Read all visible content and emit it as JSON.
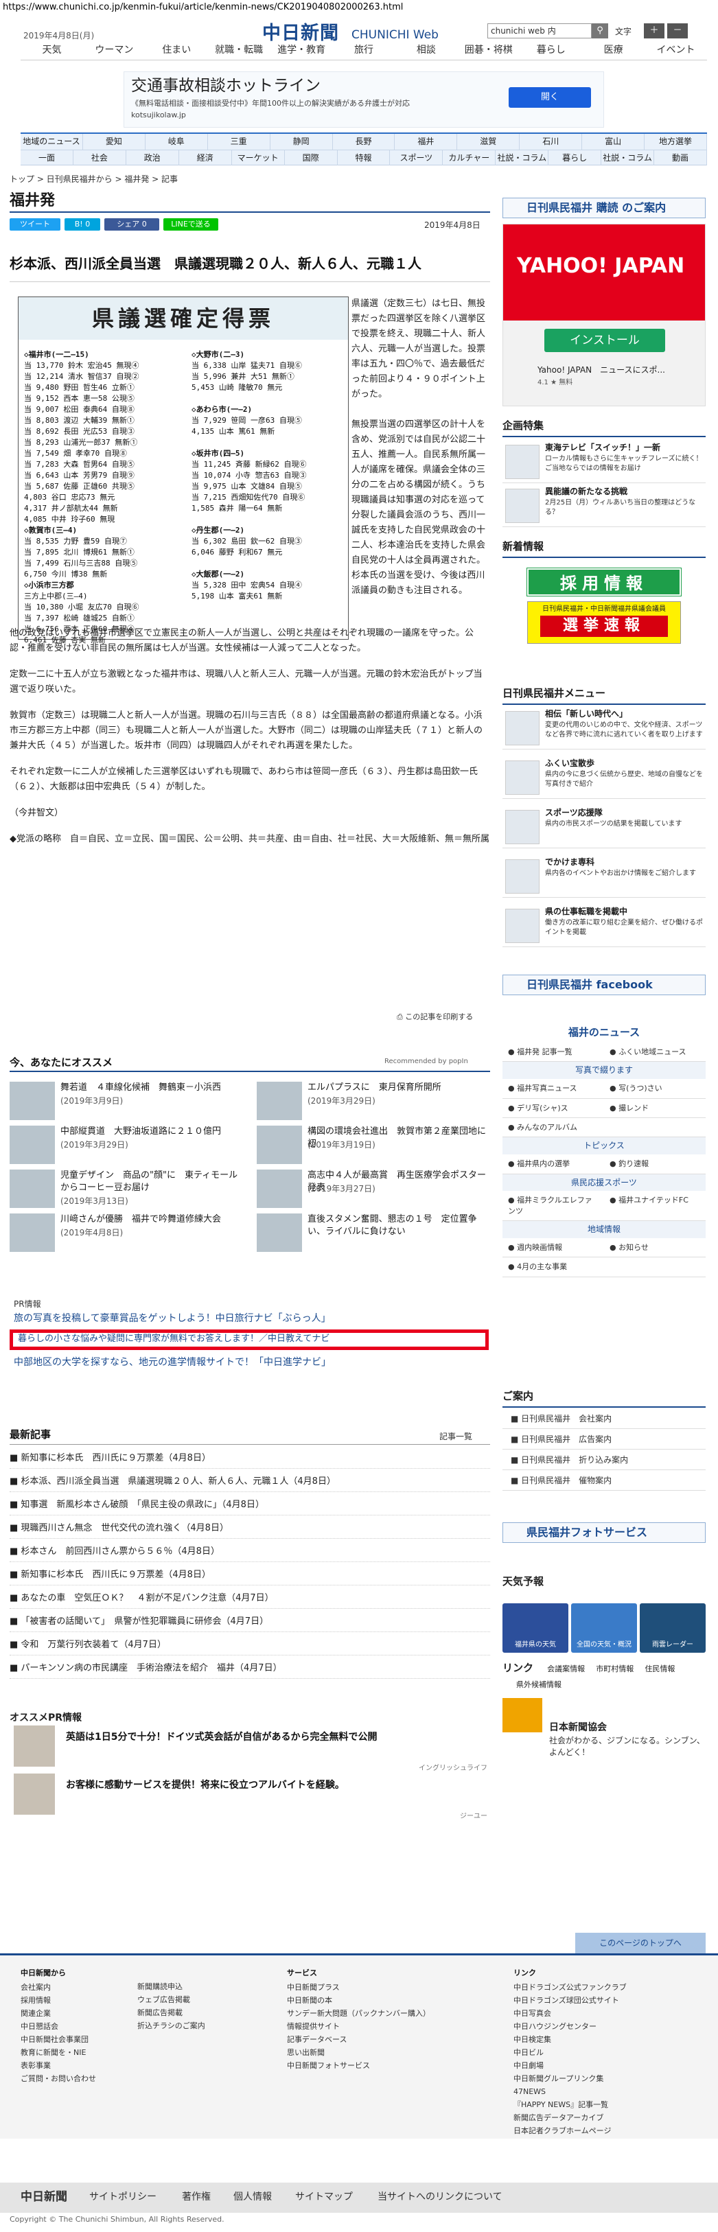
{
  "url": "https://www.chunichi.co.jp/kenmin-fukui/article/kenmin-news/CK2019040802000263.html",
  "header": {
    "date": "2019年4月8日(月)",
    "logo": "中日新聞",
    "logo_sub": "CHUNICHI Web",
    "search_value": "chunichi web 内",
    "font_label": "文字",
    "font_plus": "＋",
    "font_minus": "－"
  },
  "topnav": [
    "天気",
    "ウーマン",
    "住まい",
    "就職・転職",
    "進学・教育",
    "旅行",
    "相談",
    "囲碁・将棋",
    "暮らし",
    "医療",
    "イベント"
  ],
  "ad": {
    "title": "交通事故相談ホットライン",
    "sub": "《無料電話相談・面接相談受付中》年間100件以上の解決実績がある弁護士が対応 kotsujikolaw.jp",
    "button": "開く"
  },
  "bnav_row1": [
    "地域のニュース",
    "愛知",
    "岐阜",
    "三重",
    "静岡",
    "長野",
    "福井",
    "滋賀",
    "石川",
    "富山",
    "地方選挙"
  ],
  "bnav_row2": [
    "一面",
    "社会",
    "政治",
    "経済",
    "マーケット",
    "国際",
    "特報",
    "スポーツ",
    "カルチャー",
    "社説・コラム",
    "暮らし",
    "社説・コラム",
    "動画"
  ],
  "breadcrumb": "トップ > 日刊県民福井から > 福井発 > 記事",
  "section_title": "福井発",
  "share": {
    "tweet": "ツイート",
    "hatena": "B! 0",
    "facebook": "シェア 0",
    "line": "LINEで送る"
  },
  "article": {
    "date": "2019年4月8日",
    "title": "杉本派、西川派全員当選　県議選現職２０人、新人６人、元職１人",
    "photo_title": "県議選確定得票",
    "photo_left": [
      "◇福井市(一二―15)",
      "当 13,770 鈴木 宏治45 無現④",
      "当 12,214 清水 智信37 自現②",
      "当  9,480 野田 哲生46 立新①",
      "当  9,152 西本 恵一58 公現⑤",
      "当  9,007 松田 泰典64 自現⑧",
      "当  8,803 渡辺 大輔39 無新①",
      "当  8,692 長田 光広53 自現③",
      "当  8,293 山浦光一郎37 無新①",
      "当  7,549 畑  孝幸70 自現⑧",
      "当  7,283 大森 哲男64 自現⑤",
      "当  6,643 山本 芳男79 自現⑨",
      "当  5,687 佐藤 正雄60 共現⑤",
      "    4,803 谷口 忠応73 無元",
      "    4,317 井ノ部航太44 無新",
      "    4,085 中井 玲子60 無現",
      "◇敦賀市(三―4)",
      "当  8,535 力野  豊59 自現⑦",
      "当  7,895 北川 博規61 無新①",
      "当  7,499 石川与三吉88 自現⑤",
      "    6,750 今川 博38 無新",
      "◇小浜市三方郡",
      "   三方上中郡(三―4)",
      "当 10,380 小堀 友広70 自現⑥",
      "当  7,397 松崎 雄城25 自新①",
      "当  6,756 西本 正俊60 無現④",
      "    6,461 佐藤 杏実 無新"
    ],
    "photo_right": [
      "◇大野市(二―3)",
      "当  6,338 山岸 猛夫71 自現⑥",
      "当  5,996 兼井   大51 無新①",
      "    5,453 山崎 隆敏70 無元",
      "",
      "◇あわら市(一―2)",
      "当  7,929 笹岡 一彦63 自現⑤",
      "    4,135 山本   篤61 無新",
      "",
      "◇坂井市(四―5)",
      "当 11,245 斉藤 新緑62 自現⑥",
      "当 10,074 小寺 惣吉63 自現③",
      "当  9,975 山本 文雄84 自現⑤",
      "当  7,215 西畑知佐代70 自現⑥",
      "    1,585 森井   陽一64 無新",
      "",
      "◇丹生郡(一―2)",
      "当  6,302 島田 欽一62 自現③",
      "    6,046 藤野 利和67 無元",
      "",
      "◇大飯郡(一―2)",
      "当  5,328 田中 宏典54 自現④",
      "    5,198 山本 富夫61 無新"
    ],
    "p1": "県議選（定数三七）は七日、無投票だった四選挙区を除く八選挙区で投票を終え、現職二十人、新人六人、元職一人が当選した。投票率は五九・四〇％で、過去最低だった前回より４・９０ポイント上がった。",
    "p2": "無投票当選の四選挙区の計十人を含め、党派別では自民が公認二十五人、推薦一人。自民系無所属一人が議席を確保。県議会全体の三分の二を占める構図が続く。うち現職議員は知事選の対応を巡って分裂した議員会派のうち、西川一誠氏を支持した自民党県政会の十二人、杉本達治氏を支持した県会自民党の十人は全員再選された。杉本氏の当選を受け、今後は西川派議員の動きも注目される。",
    "p3": "他の政党はいずれも福井市選挙区で立憲民主の新人一人が当選し、公明と共産はそれぞれ現職の一議席を守った。公認・推薦を受けない非自民の無所属は七人が当選。女性候補は一人減って二人となった。",
    "p4": "定数一二に十五人が立ち激戦となった福井市は、現職八人と新人三人、元職一人が当選。元職の鈴木宏治氏がトップ当選で返り咲いた。",
    "p5": "敦賀市（定数三）は現職二人と新人一人が当選。現職の石川与三吉氏（８８）は全国最高齢の都道府県議となる。小浜市三方郡三方上中郡（同三）も現職二人と新人一人が当選した。大野市（同二）は現職の山岸猛夫氏（７１）と新人の兼井大氏（４５）が当選した。坂井市（同四）は現職四人がそれぞれ再選を果たした。",
    "p6": "それぞれ定数一に二人が立候補した三選挙区はいずれも現職で、あわら市は笹岡一彦氏（６３）、丹生郡は島田欽一氏（６２）、大飯郡は田中宏典氏（５４）が制した。",
    "p7": "（今井智文）",
    "p8": "◆党派の略称　自＝自民、立＝立民、国＝国民、公＝公明、共＝共産、由＝自由、社＝社民、大＝大阪維新、無＝無所属",
    "print": "この記事を印刷する"
  },
  "recommend": {
    "heading": "今、あなたにオススメ",
    "by": "Recommended by popIn",
    "items": [
      {
        "title": "舞若道　４車線化候補　舞鶴東－小浜西",
        "date": "(2019年3月9日)"
      },
      {
        "title": "エルパプラスに　東月保育所開所",
        "date": "(2019年3月29日)"
      },
      {
        "title": "中部縦貫道　大野油坂道路に２１０億円",
        "date": "(2019年3月29日)"
      },
      {
        "title": "構図の環境会社進出　敦賀市第２産業団地に初",
        "date": "(2019年3月19日)"
      },
      {
        "title": "児童デザイン　商品の\"顔\"に　東ティモールからコーヒー豆お届け",
        "date": "(2019年3月13日)"
      },
      {
        "title": "高志中４人が最高賞　再生医療学会ポスター発表",
        "date": "(2019年3月27日)"
      },
      {
        "title": "川﨑さんが優勝　福井で吟舞道修練大会",
        "date": "(2019年4月8日)"
      },
      {
        "title": "直後スタメン奮闘、懇志の１号　定位置争い、ライバルに負けない",
        "date": ""
      }
    ]
  },
  "pr": {
    "label": "PR情報",
    "items": [
      "旅の写真を投稿して豪華賞品をゲットしよう！中日旅行ナビ「ぶらっ人」",
      "暮らしの小さな悩みや疑問に専門家が無料でお答えします！／中日教えてナビ",
      "中部地区の大学を探すなら、地元の進学情報サイトで！「中日進学ナビ」"
    ]
  },
  "latest": {
    "heading": "最新記事",
    "more": "記事一覧",
    "items": [
      "新知事に杉本氏　西川氏に９万票差（4月8日）",
      "杉本派、西川派全員当選　県議選現職２０人、新人６人、元職１人（4月8日）",
      "知事選　新風杉本さん破顔　「県民主役の県政に」（4月8日）",
      "現職西川さん無念　世代交代の流れ強く（4月8日）",
      "杉本さん　前回西川さん票から５６％（4月8日）",
      "新知事に杉本氏　西川氏に９万票差（4月8日）",
      "あなたの車　空気圧ＯＫ？　４割が不足パンク注意（4月7日）",
      "「被害者の話聞いて」　県警が性犯罪職員に研修会（4月7日）",
      "令和　万葉行列衣装着て（4月7日）",
      "パーキンソン病の市民講座　手術治療法を紹介　福井（4月7日）"
    ]
  },
  "osusume": {
    "heading": "オススメPR情報",
    "items": [
      {
        "title": "英語は1日5分で十分！ドイツ式英会話が自信があるから完全無料で公開",
        "src": "イングリッシュライフ"
      },
      {
        "title": "お客様に感動サービスを提供！将来に役立つアルバイトを経験。",
        "src": "ジーユー"
      }
    ]
  },
  "sidebar": {
    "kounyu": "日刊県民福井 購読 のご案内",
    "yahoo": {
      "logo": "YAHOO! JAPAN",
      "install": "インストール",
      "app": "Yahoo! JAPAN　ニュースにスポ...",
      "rating": "4.1 ★ 無料"
    },
    "kikaku_h": "企画特集",
    "kikaku": [
      {
        "title": "東海テレビ「スイッチ！」一新",
        "sub": "ローカル情報もさらに生キャッチフレーズに続く！ご当地ならではの情報をお届け"
      },
      {
        "title": "異能議の新たなる挑戦",
        "sub": "2月25日（月）ウィルあいち当日の整理はどうなる？"
      }
    ],
    "shinchaku_h": "新着情報",
    "saiyou": "採用情報",
    "senkyo_small": "日刊県民福井・中日新聞福井県議会議員",
    "senkyo": "選挙速報",
    "menu_h": "日刊県民福井メニュー",
    "menu": [
      {
        "title": "相伝「新しい時代へ」",
        "sub": "変更の代用のいじめの中で、文化や経済、スポーツなど各界で時に流れに逃れていく者を取り上げます"
      },
      {
        "title": "ふくい宝散歩",
        "sub": "県内の今に息づく伝統から歴史、地域の自慢などを写真付きで紹介"
      },
      {
        "title": "スポーツ応援隊",
        "sub": "県内の市民スポーツの結果を掲載しています"
      },
      {
        "title": "でかけま専科",
        "sub": "県内各のイベントやお出かけ情報をご紹介します"
      },
      {
        "title": "県の仕事転職を掲載中",
        "sub": "働き方の改革に取り組む企業を紹介、ぜひ働けるポイントを掲載"
      }
    ],
    "facebook": "日刊県民福井 facebook",
    "fn_h": "福井のニュース",
    "fn_top": [
      "福井発 記事一覧",
      "ふくい地域ニュース"
    ],
    "fn_sub1": "写真で綴ります",
    "fn_mid": [
      "福井写真ニュース",
      "写(うつ)さい",
      "デリ写(シャ)ス",
      "撮レンド",
      "みんなのアルバム",
      ""
    ],
    "fn_sub2": "トピックス",
    "fn_top2": [
      "福井県内の選挙",
      "釣り速報"
    ],
    "fn_sub3": "県民応援スポーツ",
    "fn_top3": [
      "福井ミラクルエレファンツ",
      "福井ユナイテッドFC"
    ],
    "fn_sub4": "地域情報",
    "fn_top4": [
      "週内映画情報",
      "お知らせ",
      "4月の主な事業",
      ""
    ],
    "annai_h": "ご案内",
    "annai": [
      "日刊県民福井　会社案内",
      "日刊県民福井　広告案内",
      "日刊県民福井　折り込み案内",
      "日刊県民福井　催物案内"
    ],
    "photo_service": "県民福井フォトサービス",
    "tenki_h": "天気予報",
    "tenki": [
      "福井県の天気",
      "全国の天気・概況",
      "雨雲レーダー"
    ],
    "link_h": "リンク",
    "link_items": [
      "会議案情報",
      "市町村情報",
      "住民情報",
      "県外候補情報"
    ],
    "nihon": "日本新聞協会",
    "nihon_sub": "社会がわかる、ジブンになる。シンブン、よんどく！"
  },
  "footer": {
    "top": "このページのトップへ",
    "col1": {
      "h": "中日新聞から",
      "items": [
        "会社案内",
        "採用情報",
        "関連企業",
        "中日懇話会",
        "中日新聞社会事業団",
        "教育に新聞を・NIE",
        "表彰事業",
        "ご質問・お問い合わせ"
      ]
    },
    "col2": {
      "h": "",
      "items": [
        "新聞購読申込",
        "ウェブ広告掲載",
        "新聞広告掲載",
        "折込チラシのご案内"
      ]
    },
    "col3": {
      "h": "サービス",
      "items": [
        "中日新聞プラス",
        "中日新聞の本",
        "サンデー新大問題（パックナンバー購入）",
        "情報提供サイト",
        "記事データベース",
        "思い出新聞",
        "中日新聞フォトサービス"
      ]
    },
    "col4": {
      "h": "リンク",
      "items": [
        "中日ドラゴンズ公式ファンクラブ",
        "中日ドラゴンズ球団公式サイト",
        "中日写真会",
        "中日ハウジングセンター",
        "中日検定集",
        "中日ビル",
        "中日劇場",
        "中日新聞グループリンク集",
        "47NEWS",
        "『HAPPY NEWS』記事一覧",
        "新聞広告データアーカイブ",
        "日本記者クラブホームページ"
      ]
    },
    "bar": [
      "中日新聞",
      "サイトポリシー",
      "著作権",
      "個人情報",
      "サイトマップ",
      "当サイトへのリンクについて"
    ],
    "copy": "Copyright © The Chunichi Shimbun, All Rights Reserved."
  },
  "colors": {
    "brand": "#1a4a8e",
    "twitter": "#1da1f2",
    "hatena": "#00a4de",
    "facebook": "#3b5998",
    "line": "#00c300",
    "pr_highlight": "#e8001c"
  }
}
